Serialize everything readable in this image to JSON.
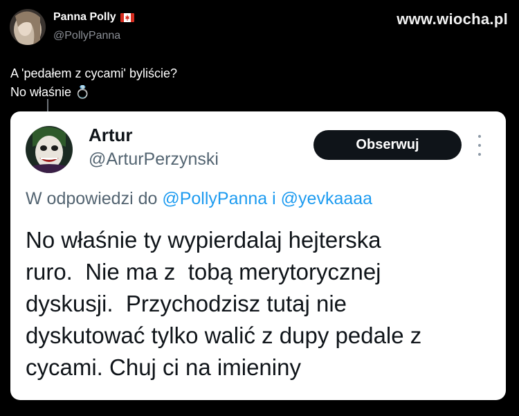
{
  "watermark": "www.wiocha.pl",
  "outer_tweet": {
    "author_name": "Panna Polly",
    "flag_icon": "canada-flag-icon",
    "handle": "@PollyPanna",
    "lines": [
      "A 'pedałem z cycami' byliście?",
      "No właśnie"
    ],
    "emoji": "💍"
  },
  "quoted_tweet": {
    "author_name": "Artur",
    "handle": "@ArturPerzynski",
    "follow_label": "Obserwuj",
    "reply_prefix": "W odpowiedzi do",
    "reply_mention_1": "@PollyPanna",
    "reply_joiner": "i",
    "reply_mention_2": "@yevkaaaa",
    "text_lines": [
      "No właśnie ty wypierdalaj hejterska",
      "ruro.  Nie ma z  tobą merytorycznej",
      "dyskusji.  Przychodzisz tutaj nie",
      "dyskutować tylko walić z dupy pedale z",
      "cycami. Chuj ci na imieniny"
    ]
  },
  "colors": {
    "background": "#000000",
    "card": "#ffffff",
    "mention": "#1d9bf0",
    "muted": "#536471",
    "button": "#0f1419"
  }
}
